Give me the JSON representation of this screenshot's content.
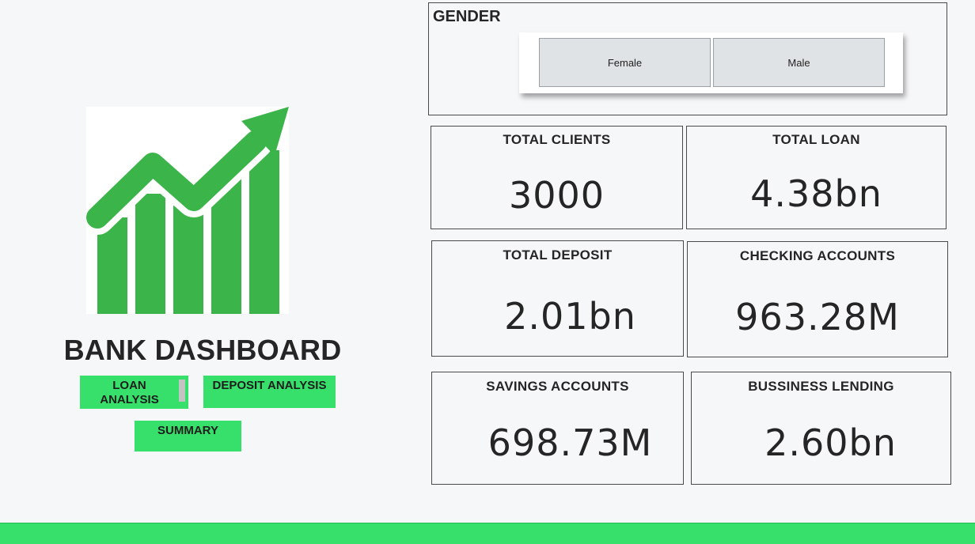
{
  "sidebar": {
    "logo_icon": "growth-chart-icon",
    "title": "BANK DASHBOARD",
    "buttons": {
      "loan_analysis": "LOAN\nANALYSIS",
      "deposit_analysis": "DEPOSIT ANALYSIS",
      "summary": "SUMMARY"
    }
  },
  "gender": {
    "title": "GENDER",
    "options": [
      "Female",
      "Male"
    ]
  },
  "kpis": [
    {
      "label": "TOTAL CLIENTS",
      "value": "3000"
    },
    {
      "label": "TOTAL LOAN",
      "value": "4.38bn"
    },
    {
      "label": "TOTAL DEPOSIT",
      "value": "2.01bn"
    },
    {
      "label": "CHECKING ACCOUNTS",
      "value": "963.28M"
    },
    {
      "label": "SAVINGS ACCOUNTS",
      "value": "698.73M"
    },
    {
      "label": "BUSSINESS LENDING",
      "value": "2.60bn"
    }
  ],
  "colors": {
    "accent": "#37e06a",
    "logo_green": "#3bb54a",
    "background": "#f6f7f9"
  }
}
